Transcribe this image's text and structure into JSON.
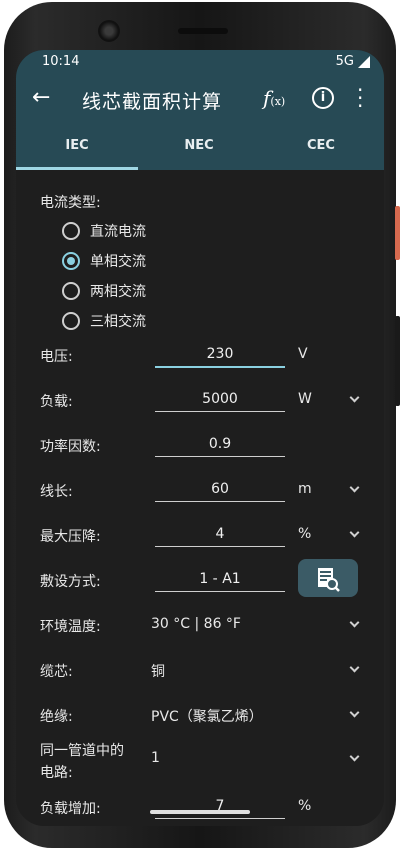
{
  "status": {
    "time": "10:14",
    "network": "5G"
  },
  "appbar": {
    "title": "线芯截面积计算",
    "fx_main": "f",
    "fx_sub": "(x)",
    "info": "i"
  },
  "tabs": [
    {
      "label": "IEC"
    },
    {
      "label": "NEC"
    },
    {
      "label": "CEC"
    }
  ],
  "current_type": {
    "label": "电流类型:",
    "options": [
      {
        "label": "直流电流",
        "selected": false
      },
      {
        "label": "单相交流",
        "selected": true
      },
      {
        "label": "两相交流",
        "selected": false
      },
      {
        "label": "三相交流",
        "selected": false
      }
    ]
  },
  "rows": {
    "voltage": {
      "label": "电压:",
      "value": "230",
      "unit": "V"
    },
    "load": {
      "label": "负载:",
      "value": "5000",
      "unit": "W"
    },
    "power_factor": {
      "label": "功率因数:",
      "value": "0.9"
    },
    "length": {
      "label": "线长:",
      "value": "60",
      "unit": "m"
    },
    "max_drop": {
      "label": "最大压降:",
      "value": "4",
      "unit": "%"
    },
    "installation": {
      "label": "敷设方式:",
      "value": "1  -  A1"
    },
    "ambient": {
      "label": "环境温度:",
      "value": "30 °C | 86 °F"
    },
    "conductor": {
      "label": "缆芯:",
      "value": "铜"
    },
    "insulation": {
      "label": "绝缘:",
      "value": "PVC（聚氯乙烯）"
    },
    "circuits": {
      "label_line1": "同一管道中的",
      "label_line2": "电路:",
      "value": "1"
    },
    "load_increase": {
      "label": "负载增加:",
      "value": "7",
      "unit": "%"
    }
  },
  "colors": {
    "appbar": "#274a55",
    "accent": "#8ad0e0",
    "background": "#1e1e1e"
  }
}
